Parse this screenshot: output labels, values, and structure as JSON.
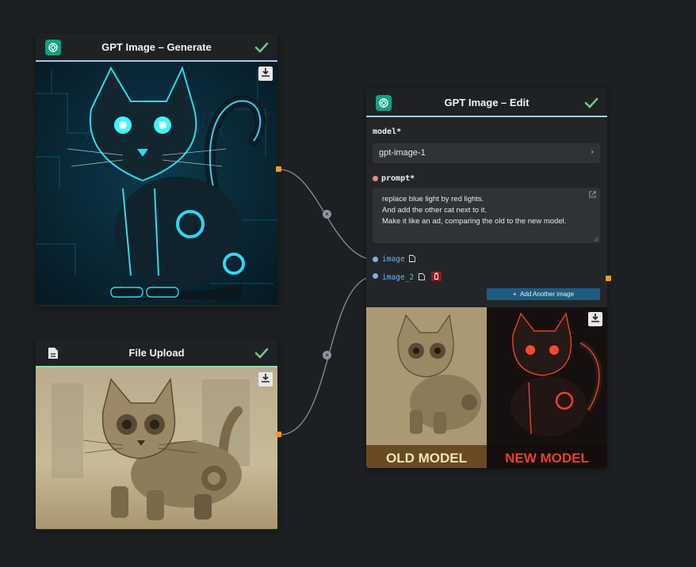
{
  "nodes": {
    "generate": {
      "title": "GPT Image – Generate",
      "status": "complete",
      "icon": "openai-icon"
    },
    "upload": {
      "title": "File Upload",
      "status": "complete",
      "icon": "file-icon"
    },
    "edit": {
      "title": "GPT Image – Edit",
      "status": "complete",
      "icon": "openai-icon",
      "model_label": "model",
      "model_value": "gpt-image-1",
      "prompt_label": "prompt",
      "required_mark": "*",
      "prompt_lines": [
        "replace blue light by red lights.",
        "And add the other cat next to it.",
        "Make it like an ad, comparing the old to the new model."
      ],
      "image_input_1": "image",
      "image_input_2": "image_2",
      "add_button_plus": "+",
      "add_button_label": "Add Another image",
      "result_caption_left": "OLD MODEL",
      "result_caption_right": "NEW MODEL"
    }
  },
  "reroute_glyph": "×",
  "colors": {
    "canvas": "#1d2022",
    "node_body": "#232628",
    "output_port": "#e89b2c",
    "link_label": "#6fb4f0",
    "accent_blue": "#1e5b80",
    "status_check": "#6fc58c",
    "prompt_dot": "#e88a7a",
    "image_dot": "#6fb4f0"
  }
}
